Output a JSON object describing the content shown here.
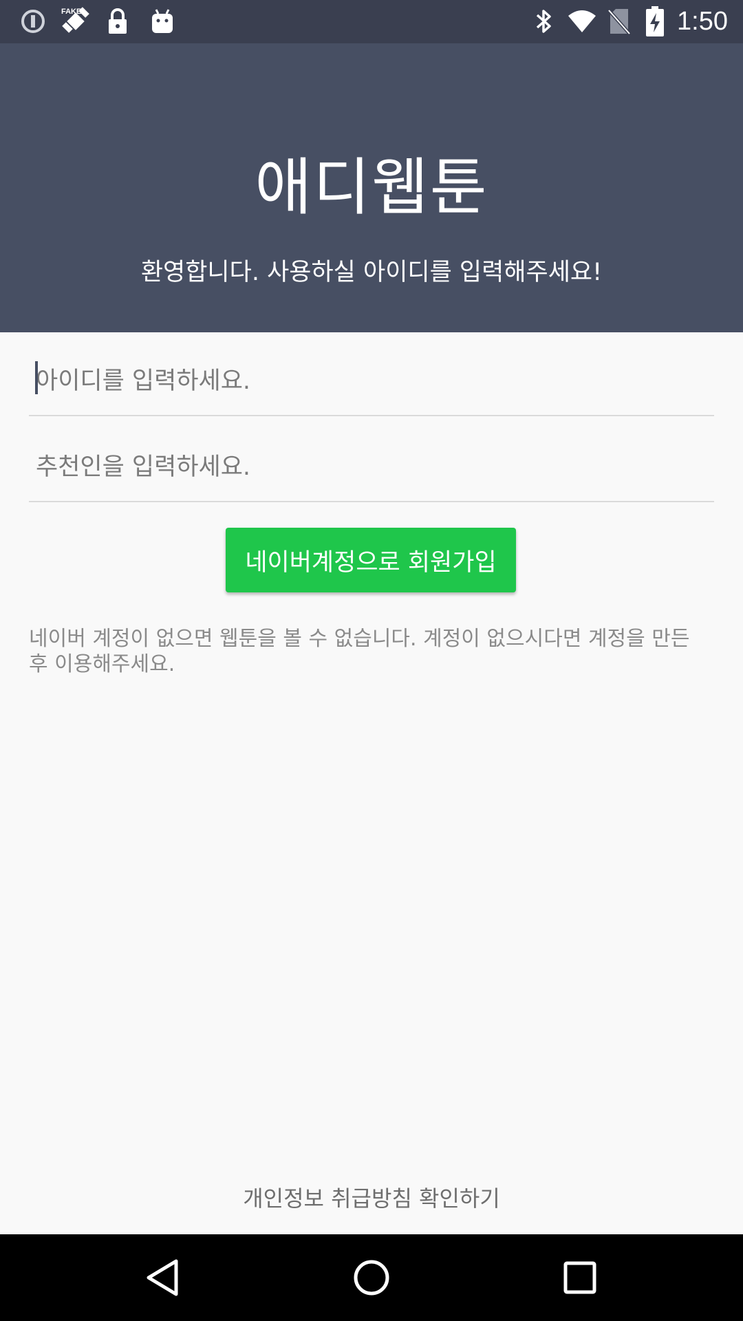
{
  "status_bar": {
    "time": "1:50",
    "left_icons": [
      "info-icon",
      "fake-gps-satellite-icon",
      "lock-icon",
      "android-icon"
    ],
    "right_icons": [
      "bluetooth-icon",
      "wifi-icon",
      "no-sim-icon",
      "battery-charging-icon"
    ]
  },
  "header": {
    "title": "애디웹툰",
    "subtitle": "환영합니다. 사용하실 아이디를 입력해주세요!",
    "background": "#474f63"
  },
  "form": {
    "id_placeholder": "아이디를 입력하세요.",
    "id_value": "",
    "recommender_placeholder": "추천인을 입력하세요.",
    "recommender_value": "",
    "join_button_label": "네이버계정으로 회원가입",
    "join_button_color": "#1fc64b",
    "notice": " 네이버 계정이 없으면 웹툰을 볼 수 없습니다. 계정이 없으시다면 계정을 만든 후 이용해주세요."
  },
  "footer": {
    "privacy_link": "개인정보 취급방침 확인하기"
  },
  "nav_bar": {
    "buttons": [
      "back-icon",
      "home-icon",
      "recents-icon"
    ]
  }
}
